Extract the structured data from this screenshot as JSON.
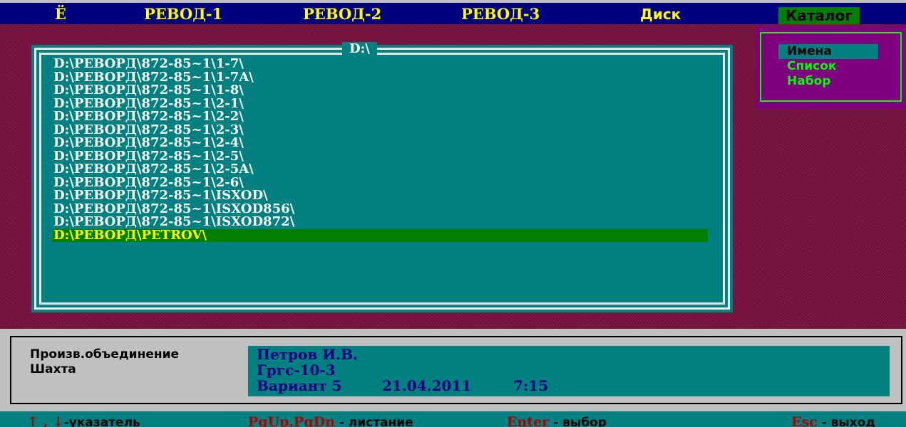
{
  "menu": {
    "items": [
      {
        "label": "Ё"
      },
      {
        "label": "PEBOД-1"
      },
      {
        "label": "PEBOД-2"
      },
      {
        "label": "PEBOД-3"
      },
      {
        "label": "Диск"
      },
      {
        "label": "Каталог"
      }
    ],
    "active": "Каталог"
  },
  "directory_window": {
    "title": "D:\\",
    "entries": [
      "D:\\PEBOPД\\872-85~1\\1-7\\",
      "D:\\PEBOPД\\872-85~1\\1-7A\\",
      "D:\\PEBOPД\\872-85~1\\1-8\\",
      "D:\\PEBOPД\\872-85~1\\2-1\\",
      "D:\\PEBOPД\\872-85~1\\2-2\\",
      "D:\\PEBOPД\\872-85~1\\2-3\\",
      "D:\\PEBOPД\\872-85~1\\2-4\\",
      "D:\\PEBOPД\\872-85~1\\2-5\\",
      "D:\\PEBOPД\\872-85~1\\2-5A\\",
      "D:\\PEBOPД\\872-85~1\\2-6\\",
      "D:\\PEBOPД\\872-85~1\\ISXOD\\",
      "D:\\PEBOPД\\872-85~1\\ISXOD856\\",
      "D:\\PEBOPД\\872-85~1\\ISXOD872\\",
      "D:\\PEBOPД\\PETROV\\"
    ],
    "selected_entry": "D:\\PEBOPД\\PETROV\\"
  },
  "catalog_menu": {
    "items": [
      "Имена",
      "Список",
      "Набор"
    ],
    "selected": "Имена"
  },
  "info": {
    "label_association": "Произв.объединение",
    "label_mine": "Шахта",
    "person": "Петров И.В.",
    "mine": "Гргс-10-3",
    "variant": "Вариант 5",
    "date": "21.04.2011",
    "time": "7:15"
  },
  "hints": {
    "arrows_key": "↑ , ↓",
    "arrows_desc": "-указатель",
    "page_key": "PgUp,PgDn",
    "page_desc": " - листание",
    "enter_key": "Enter",
    "enter_desc": " - выбор",
    "esc_key": "Esc",
    "esc_desc": " - выход"
  },
  "colors": {
    "menubar": "#00007f",
    "menu_text": "#ffff00",
    "active_menu_bg": "#007f00",
    "desktop": "#7a1240",
    "window_bg": "#008080",
    "selection_bg": "#007f00",
    "popup_bg": "#7f007f",
    "popup_text": "#00ff00",
    "panel_bg": "#c0c0c0",
    "hint_key": "#b00000"
  }
}
